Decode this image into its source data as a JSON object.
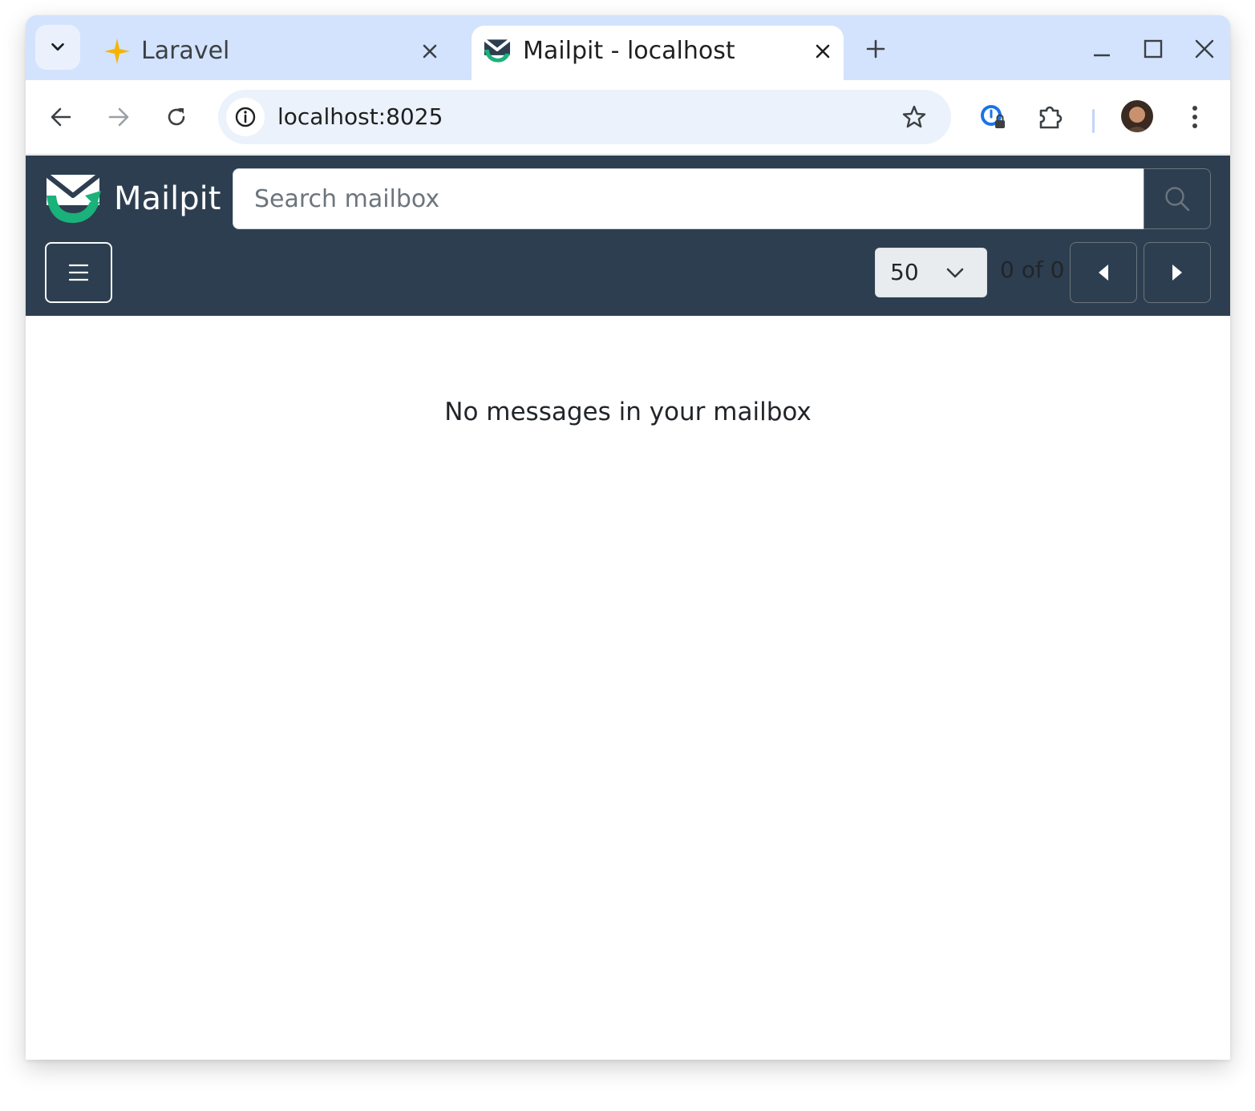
{
  "browser": {
    "tabs": [
      {
        "title": "Laravel",
        "favicon": "laravel-sparkle-icon",
        "active": false
      },
      {
        "title": "Mailpit - localhost",
        "favicon": "mailpit-logo-icon",
        "active": true
      }
    ],
    "address_bar": {
      "url": "localhost:8025"
    },
    "colors": {
      "tabstrip": "#d3e3fd",
      "omnibox": "#ecf2fb"
    }
  },
  "app": {
    "name": "Mailpit",
    "search": {
      "placeholder": "Search mailbox",
      "value": ""
    },
    "pagination": {
      "per_page": "50",
      "count_text": "0 of 0"
    },
    "empty_state": "No messages in your mailbox",
    "colors": {
      "header_bg": "#2d3e50",
      "accent_green": "#1bb17a"
    }
  }
}
